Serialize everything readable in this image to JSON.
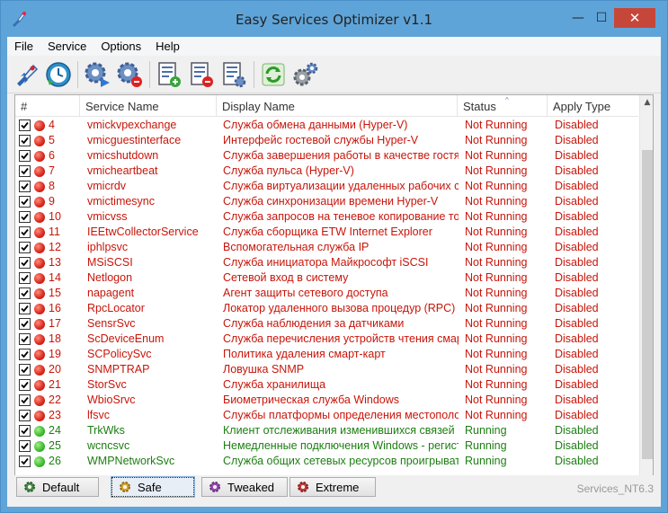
{
  "window": {
    "title": "Easy Services Optimizer v1.1",
    "minimize_label": "—",
    "maximize_label": "☐",
    "close_label": "✕"
  },
  "menu": [
    "File",
    "Service",
    "Options",
    "Help"
  ],
  "toolbar": {
    "icons": [
      "rocket-icon",
      "restore-clock-icon",
      "gear-play-icon",
      "gear-stop-icon",
      "list-add-icon",
      "list-remove-icon",
      "list-settings-icon",
      "refresh-icon",
      "settings-gears-icon"
    ]
  },
  "columns": [
    "#",
    "Service Name",
    "Display Name",
    "Status",
    "Apply Type"
  ],
  "sort_indicator": "^",
  "rows": [
    {
      "num": "4",
      "service": "vmickvpexchange",
      "display": "Служба обмена данными (Hyper-V)",
      "status": "Not Running",
      "apply": "Disabled",
      "state": "red"
    },
    {
      "num": "5",
      "service": "vmicguestinterface",
      "display": "Интерфейс гостевой службы Hyper-V",
      "status": "Not Running",
      "apply": "Disabled",
      "state": "red"
    },
    {
      "num": "6",
      "service": "vmicshutdown",
      "display": "Служба завершения работы в качестве гостя (...",
      "status": "Not Running",
      "apply": "Disabled",
      "state": "red"
    },
    {
      "num": "7",
      "service": "vmicheartbeat",
      "display": "Служба пульса (Hyper-V)",
      "status": "Not Running",
      "apply": "Disabled",
      "state": "red"
    },
    {
      "num": "8",
      "service": "vmicrdv",
      "display": "Служба виртуализации удаленных рабочих сто...",
      "status": "Not Running",
      "apply": "Disabled",
      "state": "red"
    },
    {
      "num": "9",
      "service": "vmictimesync",
      "display": "Служба синхронизации времени Hyper-V",
      "status": "Not Running",
      "apply": "Disabled",
      "state": "red"
    },
    {
      "num": "10",
      "service": "vmicvss",
      "display": "Служба запросов на теневое копирование томо...",
      "status": "Not Running",
      "apply": "Disabled",
      "state": "red"
    },
    {
      "num": "11",
      "service": "IEEtwCollectorService",
      "display": "Служба сборщика ETW Internet Explorer",
      "status": "Not Running",
      "apply": "Disabled",
      "state": "red"
    },
    {
      "num": "12",
      "service": "iphlpsvc",
      "display": "Вспомогательная служба IP",
      "status": "Not Running",
      "apply": "Disabled",
      "state": "red"
    },
    {
      "num": "13",
      "service": "MSiSCSI",
      "display": "Служба инициатора Майкрософт iSCSI",
      "status": "Not Running",
      "apply": "Disabled",
      "state": "red"
    },
    {
      "num": "14",
      "service": "Netlogon",
      "display": "Сетевой вход в систему",
      "status": "Not Running",
      "apply": "Disabled",
      "state": "red"
    },
    {
      "num": "15",
      "service": "napagent",
      "display": "Агент защиты сетевого доступа",
      "status": "Not Running",
      "apply": "Disabled",
      "state": "red"
    },
    {
      "num": "16",
      "service": "RpcLocator",
      "display": "Локатор удаленного вызова процедур (RPC)",
      "status": "Not Running",
      "apply": "Disabled",
      "state": "red"
    },
    {
      "num": "17",
      "service": "SensrSvc",
      "display": "Служба наблюдения за датчиками",
      "status": "Not Running",
      "apply": "Disabled",
      "state": "red"
    },
    {
      "num": "18",
      "service": "ScDeviceEnum",
      "display": "Служба перечисления устройств чтения смарт-...",
      "status": "Not Running",
      "apply": "Disabled",
      "state": "red"
    },
    {
      "num": "19",
      "service": "SCPolicySvc",
      "display": "Политика удаления смарт-карт",
      "status": "Not Running",
      "apply": "Disabled",
      "state": "red"
    },
    {
      "num": "20",
      "service": "SNMPTRAP",
      "display": "Ловушка SNMP",
      "status": "Not Running",
      "apply": "Disabled",
      "state": "red"
    },
    {
      "num": "21",
      "service": "StorSvc",
      "display": "Служба хранилища",
      "status": "Not Running",
      "apply": "Disabled",
      "state": "red"
    },
    {
      "num": "22",
      "service": "WbioSrvc",
      "display": "Биометрическая служба Windows",
      "status": "Not Running",
      "apply": "Disabled",
      "state": "red"
    },
    {
      "num": "23",
      "service": "lfsvc",
      "display": "Службы платформы определения местоположе...",
      "status": "Not Running",
      "apply": "Disabled",
      "state": "red"
    },
    {
      "num": "24",
      "service": "TrkWks",
      "display": "Клиент отслеживания изменившихся связей",
      "status": "Running",
      "apply": "Disabled",
      "state": "green"
    },
    {
      "num": "25",
      "service": "wcncsvc",
      "display": "Немедленные подключения Windows - регистра...",
      "status": "Running",
      "apply": "Disabled",
      "state": "green"
    },
    {
      "num": "26",
      "service": "WMPNetworkSvc",
      "display": "Служба общих сетевых ресурсов проигрывате...",
      "status": "Running",
      "apply": "Disabled",
      "state": "green"
    }
  ],
  "presets": [
    "Default",
    "Safe",
    "Tweaked",
    "Extreme"
  ],
  "active_preset": "Safe",
  "version_label": "Services_NT6.3",
  "colors": {
    "not_running": "#c8150a",
    "running": "#1d7e12",
    "title_bar": "#5fa4d8",
    "close": "#c7463a"
  }
}
